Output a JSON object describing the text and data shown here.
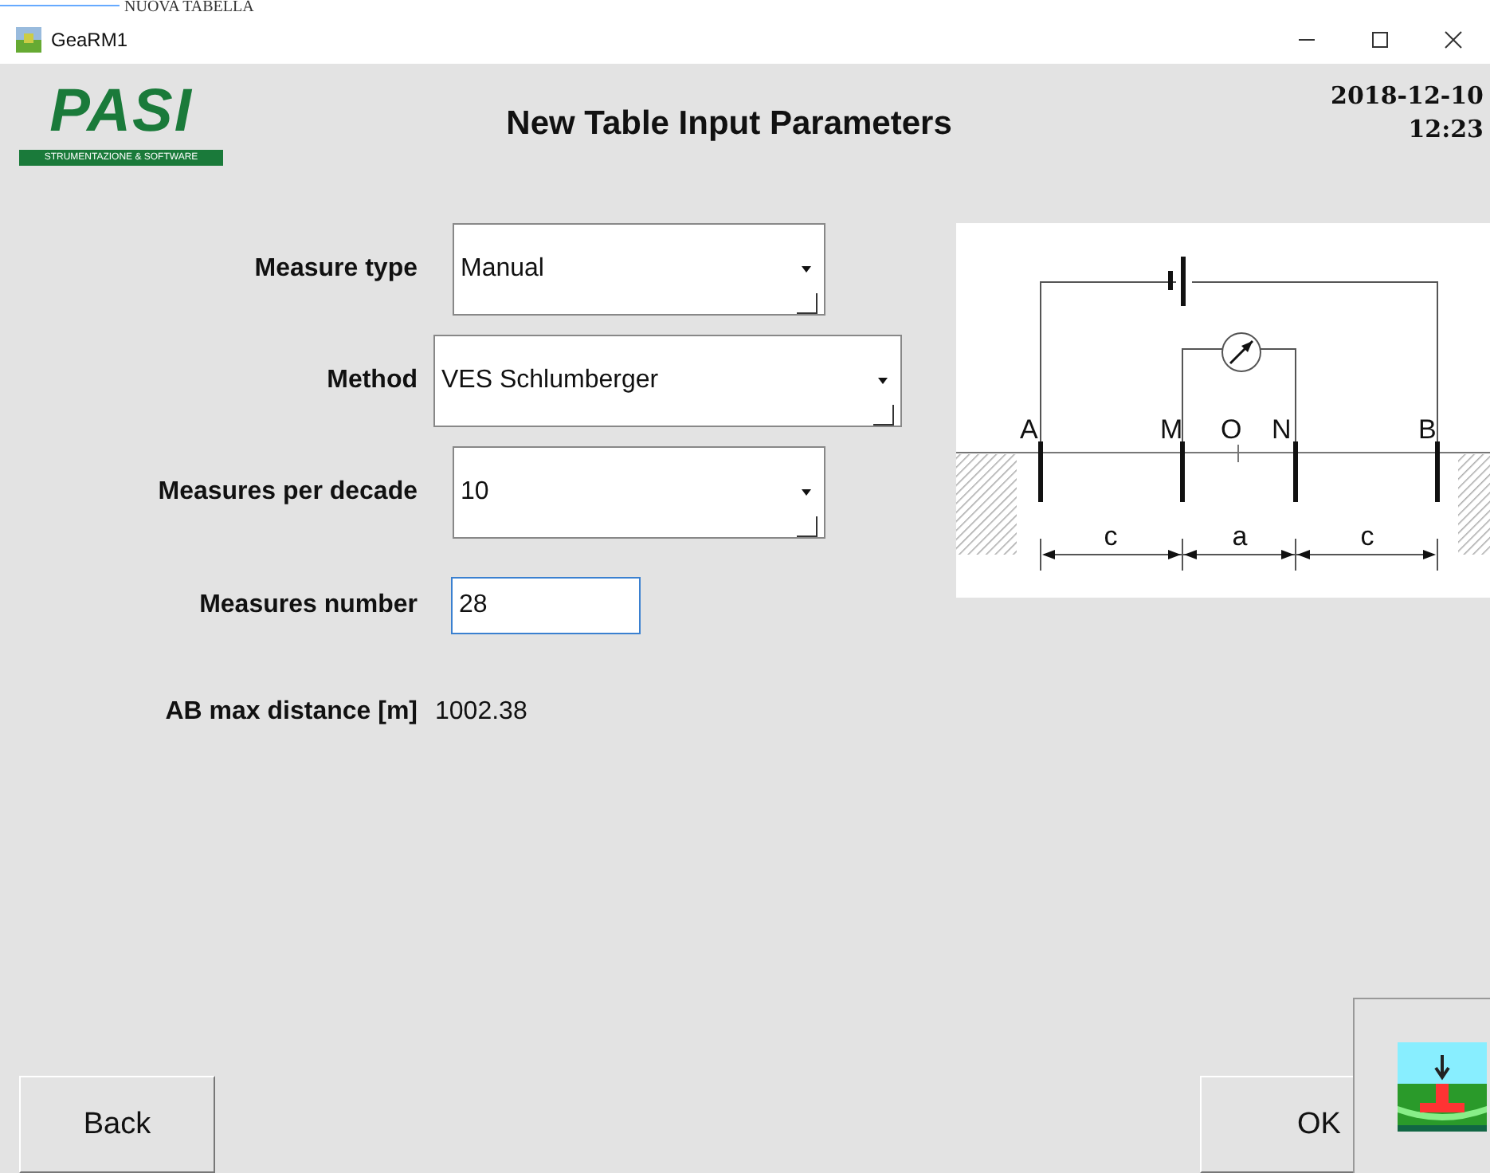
{
  "backdrop_title": "NUOVA TABELLA",
  "window": {
    "title": "GeaRM1"
  },
  "header": {
    "logo_text": "PASI",
    "logo_tagline": "STRUMENTAZIONE & SOFTWARE",
    "title": "New Table Input Parameters",
    "date": "2018-12-10",
    "time": "12:23"
  },
  "fields": [
    {
      "kind": "dropdown",
      "label": "Measure type",
      "value": "Manual"
    },
    {
      "kind": "dropdown",
      "label": "Method",
      "value": "VES Schlumberger"
    },
    {
      "kind": "dropdown",
      "label": "Measures per decade",
      "value": "10"
    },
    {
      "kind": "input",
      "label": "Measures number",
      "value": "28"
    },
    {
      "kind": "text",
      "label": "AB max distance [m]",
      "value": "1002.38"
    }
  ],
  "diagram": {
    "electrodes": [
      "A",
      "M",
      "O",
      "N",
      "B"
    ],
    "spacings": [
      "c",
      "a",
      "c"
    ]
  },
  "buttons": {
    "back": "Back",
    "ok": "OK"
  }
}
